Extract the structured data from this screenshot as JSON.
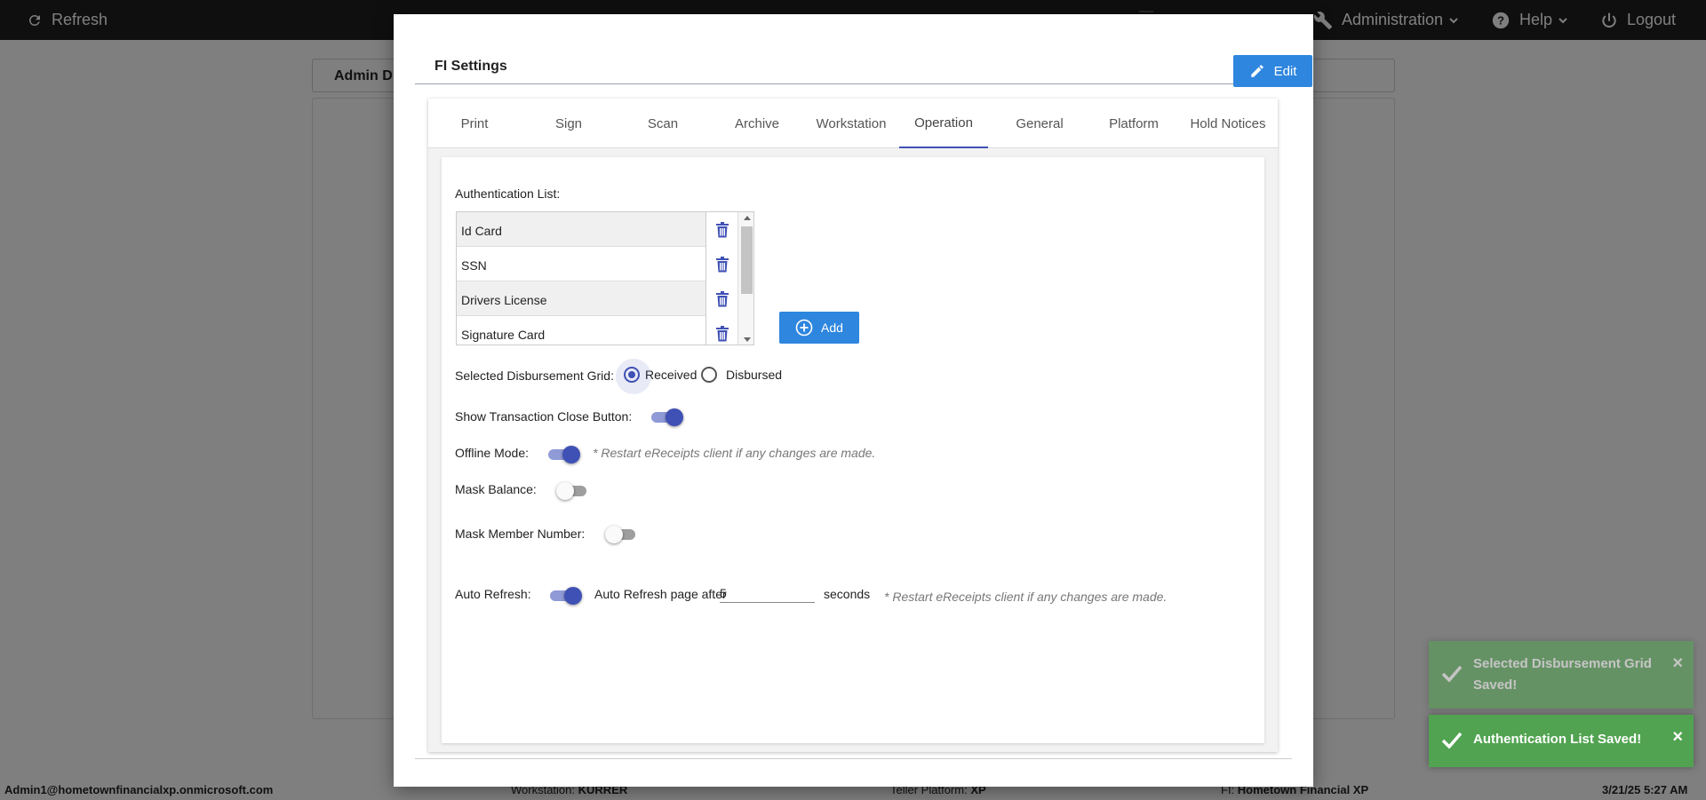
{
  "topbar": {
    "refresh_label": "Refresh",
    "administration_label": "Administration",
    "help_label": "Help",
    "logout_label": "Logout"
  },
  "background": {
    "tab_label": "Admin D"
  },
  "statusbar": {
    "user": "Admin1@hometownfinancialxp.onmicrosoft.com",
    "workstation_label": "Workstation:",
    "workstation_value": "KURRER",
    "teller_platform_label": "Teller Platform:",
    "teller_platform_value": "XP",
    "fi_label": "FI:",
    "fi_value": "Hometown Financial XP",
    "datetime": "3/21/25 5:27 AM"
  },
  "modal": {
    "title": "FI Settings",
    "edit_label": "Edit",
    "tabs": [
      {
        "label": "Print"
      },
      {
        "label": "Sign"
      },
      {
        "label": "Scan"
      },
      {
        "label": "Archive"
      },
      {
        "label": "Workstation"
      },
      {
        "label": "Operation"
      },
      {
        "label": "General"
      },
      {
        "label": "Platform"
      },
      {
        "label": "Hold Notices"
      }
    ],
    "active_tab": "Operation"
  },
  "operation": {
    "authentication_list_label": "Authentication List:",
    "authentication_items": [
      {
        "label": "Id Card"
      },
      {
        "label": "SSN"
      },
      {
        "label": "Drivers License"
      },
      {
        "label": "Signature Card"
      }
    ],
    "add_label": "Add",
    "disbursement_grid_label": "Selected Disbursement Grid:",
    "disbursement_options": [
      {
        "label": "Received",
        "checked": true
      },
      {
        "label": "Disbursed",
        "checked": false
      }
    ],
    "show_close_button_label": "Show Transaction Close Button:",
    "show_close_button_on": true,
    "offline_mode_label": "Offline Mode:",
    "offline_mode_on": true,
    "restart_note": "* Restart eReceipts client if any changes are made.",
    "mask_balance_label": "Mask Balance:",
    "mask_balance_on": false,
    "mask_member_number_label": "Mask Member Number:",
    "mask_member_number_on": false,
    "auto_refresh_label": "Auto Refresh:",
    "auto_refresh_on": true,
    "auto_refresh_after_label": "Auto Refresh page after",
    "auto_refresh_seconds_value": "5",
    "seconds_label": "seconds"
  },
  "toasts": [
    {
      "message": "Selected Disbursement Grid Saved!"
    },
    {
      "message": "Authentication List Saved!"
    }
  ],
  "colors": {
    "primary_button": "#2e86de",
    "accent": "#3f51b5",
    "toast_success": "#51a351",
    "topbar": "#1f1f1f"
  }
}
